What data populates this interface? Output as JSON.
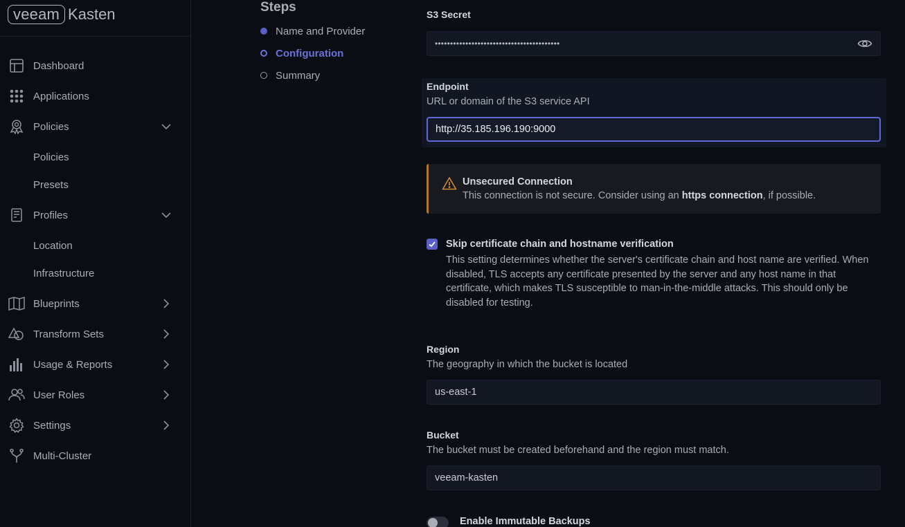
{
  "logo": {
    "brand": "veeam",
    "product": "Kasten"
  },
  "sidebar": {
    "items": [
      {
        "label": "Dashboard",
        "icon": "dashboard-icon"
      },
      {
        "label": "Applications",
        "icon": "grid-icon"
      },
      {
        "label": "Policies",
        "icon": "award-icon",
        "expanded": true
      },
      {
        "label": "Policies",
        "sub": true
      },
      {
        "label": "Presets",
        "sub": true
      },
      {
        "label": "Profiles",
        "icon": "document-icon",
        "expanded": true
      },
      {
        "label": "Location",
        "sub": true
      },
      {
        "label": "Infrastructure",
        "sub": true
      },
      {
        "label": "Blueprints",
        "icon": "map-icon"
      },
      {
        "label": "Transform Sets",
        "icon": "shapes-icon"
      },
      {
        "label": "Usage & Reports",
        "icon": "bar-chart-icon"
      },
      {
        "label": "User Roles",
        "icon": "users-icon"
      },
      {
        "label": "Settings",
        "icon": "gear-icon"
      },
      {
        "label": "Multi-Cluster",
        "icon": "fork-icon"
      }
    ]
  },
  "steps": {
    "title": "Steps",
    "items": [
      {
        "label": "Name and Provider",
        "state": "done"
      },
      {
        "label": "Configuration",
        "state": "active"
      },
      {
        "label": "Summary",
        "state": "pending"
      }
    ]
  },
  "form": {
    "s3_secret": {
      "label": "S3 Secret",
      "value": "•••••••••••••••••••••••••••••••••••••••••"
    },
    "endpoint": {
      "label": "Endpoint",
      "help": "URL or domain of the S3 service API",
      "value": "http://35.185.196.190:9000"
    },
    "warning": {
      "title": "Unsecured Connection",
      "text_before": "This connection is not secure. Consider using an ",
      "text_bold": "https connection",
      "text_after": ", if possible."
    },
    "skip_verification": {
      "label": "Skip certificate chain and hostname verification",
      "checked": true,
      "description": "This setting determines whether the server's certificate chain and host name are verified. When disabled, TLS accepts any certificate presented by the server and any host name in that certificate, which makes TLS susceptible to man-in-the-middle attacks. This should only be disabled for testing."
    },
    "region": {
      "label": "Region",
      "help": "The geography in which the bucket is located",
      "value": "us-east-1"
    },
    "bucket": {
      "label": "Bucket",
      "help": "The bucket must be created beforehand and the region must match.",
      "value": "veeam-kasten"
    },
    "immutable": {
      "label": "Enable Immutable Backups",
      "enabled": false
    }
  },
  "colors": {
    "accent": "#5b60c9",
    "focus": "#6168d6",
    "warning": "#b0762a",
    "background": "#0a0d14"
  }
}
